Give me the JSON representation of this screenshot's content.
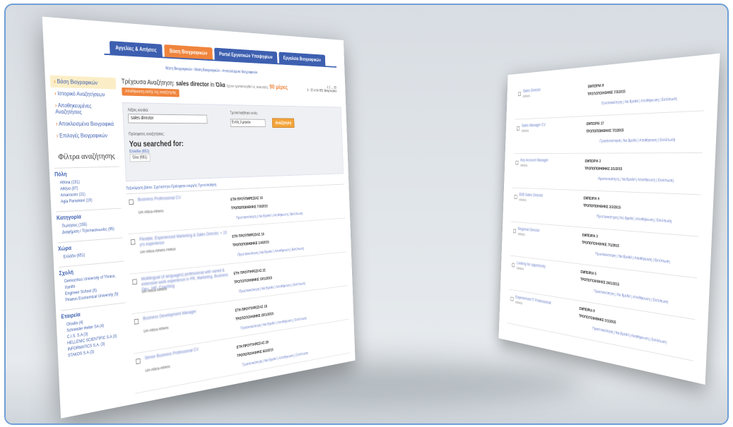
{
  "tabs": [
    {
      "label": "Αγγελίες & Αιτήσεις"
    },
    {
      "label": "Βάση Βιογραφικών"
    },
    {
      "label": "Portal Εργατικών Υποψηφίων"
    },
    {
      "label": "Εργαλεία Βιογραφικών"
    }
  ],
  "breadcrumb": "Βάση Βιογραφικών › Βάση Βιογραφικών › Αποτελέσματα Βιογραφικών",
  "sidebar": {
    "items": [
      {
        "label": "Βάση Βιογραφικών"
      },
      {
        "label": "Ιστορικό Αναζητήσεων"
      },
      {
        "label": "Αποθηκευμένες Αναζητήσεις"
      },
      {
        "label": "Αποκλεισμένα Βιογραφικά"
      },
      {
        "label": "Επιλογές Βιογραφικών"
      }
    ],
    "filters_title": "Φίλτρα αναζήτησης",
    "groups": [
      {
        "title": "Πόλη",
        "items": [
          "Athina (151)",
          "Αθήνα (87)",
          "Amarousio (21)",
          "Agia Paraskevi (19)"
        ]
      },
      {
        "title": "Κατηγορία",
        "items": [
          "Πωλήσεις (155)",
          "Διαφήμιση / Τηλεπικοινωνίες (95)"
        ]
      },
      {
        "title": "Χώρα",
        "items": [
          "Ελλάδα (651)"
        ]
      },
      {
        "title": "Σχολή",
        "items": [
          "Democritus University of Thrace, Xanthi",
          "Engineer School (5)",
          "Piraeus Economical University (5)"
        ]
      },
      {
        "title": "Εταιρεία",
        "items": [
          "Otsalia (4)",
          "Schneider Heller SA (4)",
          "C.I.S. S.A (3)",
          "HELLENIC SCIENTIFIC S.A (3)",
          "INFORMATICS S.A. (3)",
          "STAKOS S.A (3)"
        ]
      }
    ]
  },
  "main": {
    "current_search_label": "Τρέχουσα Αναζήτηση:",
    "query": "sales director",
    "in_label": "in",
    "scope": "Όλα",
    "period_text": "έχουν τροποποιηθεί τις τελευταίες",
    "days": "90 μέρες",
    "pager": "1 2 ... 33",
    "count_text": "1 - 20 από 651 Βιογραφικά",
    "save_search": "Αποθήκευση αυτής της αναζήτησης",
    "keywords_label": "Λέξεις κλειδιά:",
    "keywords_value": "sales director",
    "modified_label": "Τροποποιήθηκε εντός:",
    "modified_value": "Εντός 3 μηνών",
    "search_button": "Αναζήτηση",
    "recent_label": "Πρόσφατες αναζητήσεις:",
    "you_searched": "You searched for:",
    "count_tabs": [
      "Ελλάδα (651)",
      "Όλα (651)"
    ],
    "sort_bar": "Ταξινόμηση βάσει: Σχετικότητα Πρόσφατα ενεργός Τροποποίηση",
    "results": [
      {
        "title": "Business Professional CV",
        "sub": "GR-Attica-Athens",
        "years": "ΕΤΗ ΠΡΟΫΠΗΡΕΣΙΑΣ 16",
        "mod": "ΤΡΟΠΟΠΟΙΗΘΗΚΕ 7/3/2015"
      },
      {
        "title": "Flexible, Experienced Marketing & Sales Director, + 15 yrs experience",
        "sub": "GR-Attica-Athens Pefkos",
        "years": "ΕΤΗ ΠΡΟΫΠΗΡΕΣΙΑΣ 16",
        "mod": "ΤΡΟΠΟΠΟΙΗΘΗΚΕ 1/4/2015"
      },
      {
        "title": "Multilingual (4 languages) professional with varied & extensive work experience in PR, Marketing, Business Dev., HR, Coaching",
        "sub": "GR-Attica-Athens",
        "years": "ΕΤΗ ΠΡΟΫΠΗΡΕΣΙΑΣ 21",
        "mod": "ΤΡΟΠΟΠΟΙΗΘΗΚΕ 19/1/2015"
      },
      {
        "title": "Business Development Manager",
        "sub": "GR-Attica-Athens",
        "years": "ΕΤΗ ΠΡΟΫΠΗΡΕΣΙΑΣ 18",
        "mod": "ΤΡΟΠΟΠΟΙΗΘΗΚΕ 20/1/2015"
      },
      {
        "title": "Senior Business Professional CV",
        "sub": "GR-Attica-Athens",
        "years": "ΕΤΗ ΠΡΟΫΠΗΡΕΣΙΑΣ 20",
        "mod": "ΤΡΟΠΟΠΟΙΗΘΗΚΕ 6/1/2015"
      }
    ],
    "actions": "Προεπισκόπηση | Να Βρεθεί | Αποθήκευση | Εκτύπωση"
  },
  "back_results": [
    {
      "title": "Sales Director",
      "sub": "Athens",
      "k1": "ΕΜΠΕΙΡΙΑ 9",
      "k2": "ΤΡΟΠΟΠΟΙΗΘΗΚΕ 7/3/2015"
    },
    {
      "title": "Sales Manager CV",
      "sub": "Athens",
      "k1": "ΕΜΠΕΙΡΙΑ 17",
      "k2": "ΤΡΟΠΟΠΟΙΗΘΗΚΕ 7/1/2015"
    },
    {
      "title": "Key Account Manager",
      "sub": "Athens",
      "k1": "ΕΜΠΕΙΡΙΑ 3",
      "k2": "ΤΡΟΠΟΠΟΙΗΘΗΚΕ 2/1/2015"
    },
    {
      "title": "B2B Sales Director",
      "sub": "Athens",
      "k1": "ΕΜΠΕΙΡΙΑ 9",
      "k2": "ΤΡΟΠΟΠΟΙΗΘΗΚΕ 2/3/2015"
    },
    {
      "title": "Regional Director",
      "sub": "Athens",
      "k1": "ΕΜΠΕΙΡΙΑ 3",
      "k2": "ΤΡΟΠΟΠΟΙΗΘΗΚΕ 7/1/2015"
    },
    {
      "title": "Looking for opportunity",
      "sub": "Athens",
      "k1": "ΕΜΠΕΙΡΙΑ 5",
      "k2": "ΤΡΟΠΟΠΟΙΗΘΗΚΕ 24/1/2015"
    },
    {
      "title": "Experienced IT Professional",
      "sub": "Athens",
      "k1": "ΕΜΠΕΙΡΙΑ 9",
      "k2": "ΤΡΟΠΟΠΟΙΗΘΗΚΕ 5/1/2015"
    }
  ],
  "back_actions": "Προεπισκόπηση | Να Βρεθεί | Αποθήκευση | Εκτύπωση"
}
